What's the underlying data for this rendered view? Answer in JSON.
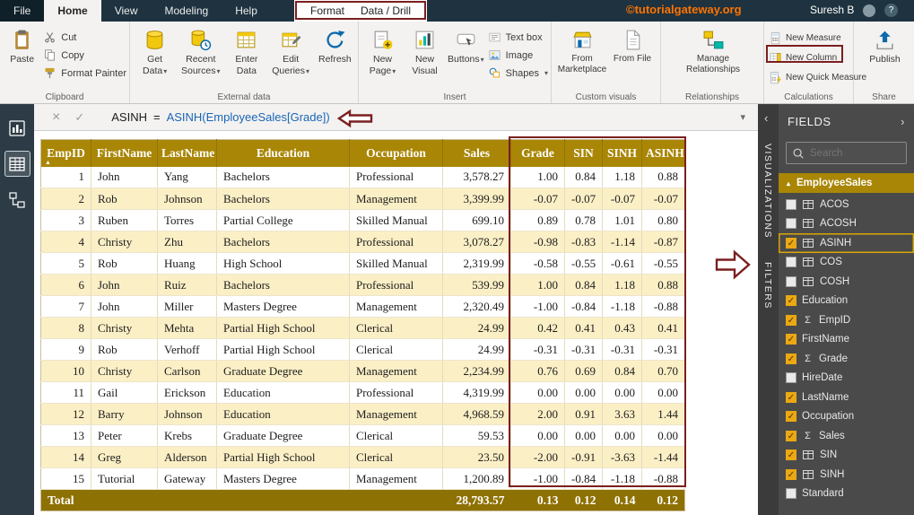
{
  "titlebar": {
    "tabs": {
      "file": "File",
      "home": "Home",
      "view": "View",
      "modeling": "Modeling",
      "help": "Help"
    },
    "contextual_tabs": {
      "format": "Format",
      "data_drill": "Data / Drill"
    },
    "watermark": "©tutorialgateway.org",
    "user_name": "Suresh B",
    "help_label": "?"
  },
  "ribbon": {
    "clipboard": {
      "label": "Clipboard",
      "paste": "Paste",
      "cut": "Cut",
      "copy": "Copy",
      "format_painter": "Format Painter"
    },
    "external_data": {
      "label": "External data",
      "get_data": "Get Data",
      "recent_sources": "Recent Sources",
      "enter_data": "Enter Data",
      "edit_queries": "Edit Queries",
      "refresh": "Refresh"
    },
    "insert": {
      "label": "Insert",
      "new_page": "New Page",
      "new_visual": "New Visual",
      "buttons": "Buttons",
      "text_box": "Text box",
      "image": "Image",
      "shapes": "Shapes"
    },
    "custom_visuals": {
      "label": "Custom visuals",
      "from_marketplace": "From Marketplace",
      "from_file": "From File"
    },
    "relationships": {
      "label": "Relationships",
      "manage_relationships": "Manage Relationships"
    },
    "calculations": {
      "label": "Calculations",
      "new_measure": "New Measure",
      "new_column": "New Column",
      "new_quick_measure": "New Quick Measure"
    },
    "share": {
      "label": "Share",
      "publish": "Publish"
    }
  },
  "formula_bar": {
    "field_name": "ASINH",
    "operator": "=",
    "expression": "ASINH(EmployeeSales[Grade])"
  },
  "table": {
    "columns": [
      "EmpID",
      "FirstName",
      "LastName",
      "Education",
      "Occupation",
      "Sales",
      "Grade",
      "SIN",
      "SINH",
      "ASINH"
    ],
    "rows": [
      [
        "1",
        "John",
        "Yang",
        "Bachelors",
        "Professional",
        "3,578.27",
        "1.00",
        "0.84",
        "1.18",
        "0.88"
      ],
      [
        "2",
        "Rob",
        "Johnson",
        "Bachelors",
        "Management",
        "3,399.99",
        "-0.07",
        "-0.07",
        "-0.07",
        "-0.07"
      ],
      [
        "3",
        "Ruben",
        "Torres",
        "Partial College",
        "Skilled Manual",
        "699.10",
        "0.89",
        "0.78",
        "1.01",
        "0.80"
      ],
      [
        "4",
        "Christy",
        "Zhu",
        "Bachelors",
        "Professional",
        "3,078.27",
        "-0.98",
        "-0.83",
        "-1.14",
        "-0.87"
      ],
      [
        "5",
        "Rob",
        "Huang",
        "High School",
        "Skilled Manual",
        "2,319.99",
        "-0.58",
        "-0.55",
        "-0.61",
        "-0.55"
      ],
      [
        "6",
        "John",
        "Ruiz",
        "Bachelors",
        "Professional",
        "539.99",
        "1.00",
        "0.84",
        "1.18",
        "0.88"
      ],
      [
        "7",
        "John",
        "Miller",
        "Masters Degree",
        "Management",
        "2,320.49",
        "-1.00",
        "-0.84",
        "-1.18",
        "-0.88"
      ],
      [
        "8",
        "Christy",
        "Mehta",
        "Partial High School",
        "Clerical",
        "24.99",
        "0.42",
        "0.41",
        "0.43",
        "0.41"
      ],
      [
        "9",
        "Rob",
        "Verhoff",
        "Partial High School",
        "Clerical",
        "24.99",
        "-0.31",
        "-0.31",
        "-0.31",
        "-0.31"
      ],
      [
        "10",
        "Christy",
        "Carlson",
        "Graduate Degree",
        "Management",
        "2,234.99",
        "0.76",
        "0.69",
        "0.84",
        "0.70"
      ],
      [
        "11",
        "Gail",
        "Erickson",
        "Education",
        "Professional",
        "4,319.99",
        "0.00",
        "0.00",
        "0.00",
        "0.00"
      ],
      [
        "12",
        "Barry",
        "Johnson",
        "Education",
        "Management",
        "4,968.59",
        "2.00",
        "0.91",
        "3.63",
        "1.44"
      ],
      [
        "13",
        "Peter",
        "Krebs",
        "Graduate Degree",
        "Clerical",
        "59.53",
        "0.00",
        "0.00",
        "0.00",
        "0.00"
      ],
      [
        "14",
        "Greg",
        "Alderson",
        "Partial High School",
        "Clerical",
        "23.50",
        "-2.00",
        "-0.91",
        "-3.63",
        "-1.44"
      ],
      [
        "15",
        "Tutorial",
        "Gateway",
        "Masters Degree",
        "Management",
        "1,200.89",
        "-1.00",
        "-0.84",
        "-1.18",
        "-0.88"
      ]
    ],
    "total": [
      "Total",
      "",
      "",
      "",
      "",
      "28,793.57",
      "0.13",
      "0.12",
      "0.14",
      "0.12"
    ]
  },
  "panels": {
    "collapsed": {
      "visualizations": "VISUALIZATIONS",
      "filters": "FILTERS"
    },
    "fields": {
      "title": "FIELDS",
      "search_placeholder": "Search",
      "table_name": "EmployeeSales",
      "fields": [
        {
          "name": "ACOS",
          "checked": false,
          "icon": "calc"
        },
        {
          "name": "ACOSH",
          "checked": false,
          "icon": "calc"
        },
        {
          "name": "ASINH",
          "checked": true,
          "icon": "calc",
          "highlighted": true
        },
        {
          "name": "COS",
          "checked": false,
          "icon": "calc"
        },
        {
          "name": "COSH",
          "checked": false,
          "icon": "calc"
        },
        {
          "name": "Education",
          "checked": true,
          "icon": ""
        },
        {
          "name": "EmpID",
          "checked": true,
          "icon": "sigma"
        },
        {
          "name": "FirstName",
          "checked": true,
          "icon": ""
        },
        {
          "name": "Grade",
          "checked": true,
          "icon": "sigma"
        },
        {
          "name": "HireDate",
          "checked": false,
          "icon": ""
        },
        {
          "name": "LastName",
          "checked": true,
          "icon": ""
        },
        {
          "name": "Occupation",
          "checked": true,
          "icon": ""
        },
        {
          "name": "Sales",
          "checked": true,
          "icon": "sigma"
        },
        {
          "name": "SIN",
          "checked": true,
          "icon": "calc"
        },
        {
          "name": "SINH",
          "checked": true,
          "icon": "calc"
        },
        {
          "name": "Standard",
          "checked": false,
          "icon": ""
        }
      ]
    }
  },
  "colors": {
    "accent_gold": "#A98605",
    "annotation_red": "#7A1F1F",
    "checkbox_gold": "#EBA812",
    "watermark_orange": "#FF7300",
    "formula_blue": "#1B66B5"
  }
}
